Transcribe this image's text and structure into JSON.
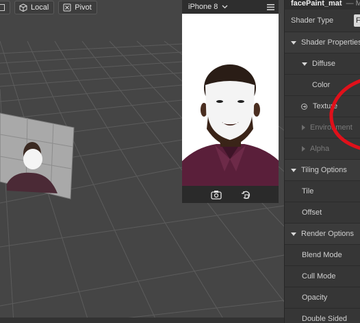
{
  "toolbar": {
    "local_label": "Local",
    "pivot_label": "Pivot"
  },
  "preview": {
    "device_label": "iPhone 8"
  },
  "inspector": {
    "title": "facePaint_mat",
    "title_tail": "— M",
    "shader_type_label": "Shader Type",
    "shader_type_value": "Fl",
    "rows": {
      "shader_properties": "Shader Properties",
      "diffuse": "Diffuse",
      "color": "Color",
      "texture": "Texture",
      "environment": "Environment",
      "alpha": "Alpha",
      "tiling_options": "Tiling Options",
      "tile": "Tile",
      "offset": "Offset",
      "render_options": "Render Options",
      "blend_mode": "Blend Mode",
      "cull_mode": "Cull Mode",
      "opacity": "Opacity",
      "double_sided": "Double Sided"
    }
  },
  "colors": {
    "annotation_red": "#e0101a",
    "viewport_bg": "#454545",
    "inspector_bg": "#363636"
  },
  "icons": [
    "cube-icon",
    "pivot-icon",
    "chevron-down-icon",
    "hamburger-menu-icon",
    "camera-flip-icon",
    "rotate-icon",
    "texture-link-icon"
  ]
}
